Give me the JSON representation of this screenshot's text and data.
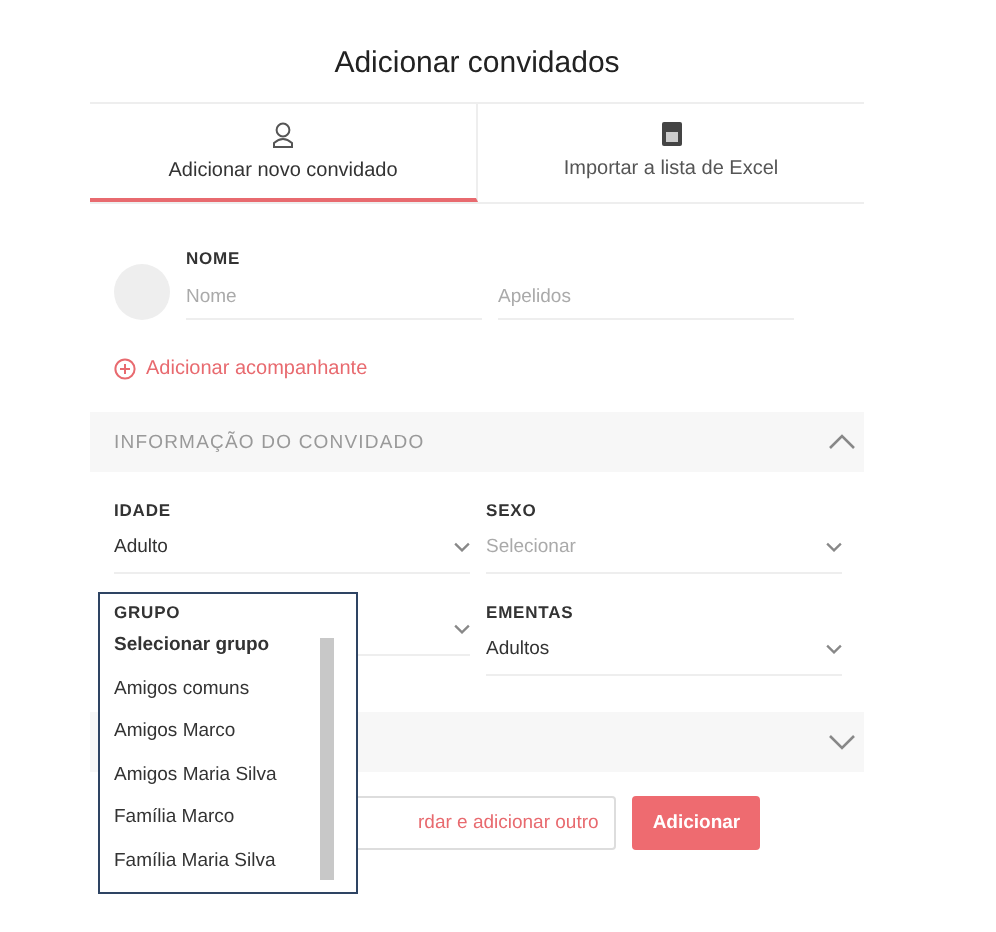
{
  "title": "Adicionar convidados",
  "tabs": [
    {
      "label": "Adicionar novo convidado",
      "selected": true
    },
    {
      "label": "Importar a lista de Excel",
      "selected": false
    }
  ],
  "name_section": {
    "label": "NOME",
    "fields": [
      {
        "placeholder": "Nome"
      },
      {
        "placeholder": "Apelidos"
      }
    ]
  },
  "add_companion": "Adicionar acompanhante",
  "guest_info": {
    "title": "INFORMAÇÃO DO CONVIDADO",
    "expanded": true
  },
  "selects": [
    {
      "label": "IDADE",
      "value": "Adulto"
    },
    {
      "label": "SEXO",
      "placeholder": "Selecionar"
    },
    {
      "label": "GRUPO",
      "kind": "open"
    },
    {
      "label": "EMENTAS",
      "value": "Adultos"
    }
  ],
  "group_dropdown": {
    "options": [
      {
        "label": "Selecionar grupo",
        "selected": true
      },
      {
        "label": "Amigos comuns",
        "selected": false
      },
      {
        "label": "Amigos Marco",
        "selected": false
      },
      {
        "label": "Amigos Maria Silva",
        "selected": false
      },
      {
        "label": "Família Marco",
        "selected": false
      },
      {
        "label": "Família Maria Silva",
        "selected": false
      }
    ]
  },
  "second_section": {
    "expanded": false
  },
  "buttons": [
    {
      "label": "rdar e adicionar outro",
      "kind": "secondary"
    },
    {
      "label": "Adicionar",
      "kind": "primary"
    }
  ]
}
